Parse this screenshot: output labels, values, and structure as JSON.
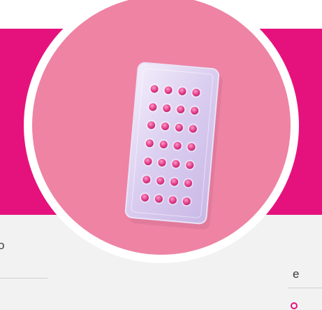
{
  "colors": {
    "brand": "#e5127d",
    "circle": "#ee83a4",
    "pack": "#d9ccef",
    "pill": "#e43f8d",
    "strip": "#f2f2f2",
    "text": "#3a3a3a"
  },
  "left_panel": {
    "text_fragment": "o"
  },
  "right_panel": {
    "text_fragment": "e"
  },
  "main_image": {
    "subject": "pill-pack-icon"
  }
}
